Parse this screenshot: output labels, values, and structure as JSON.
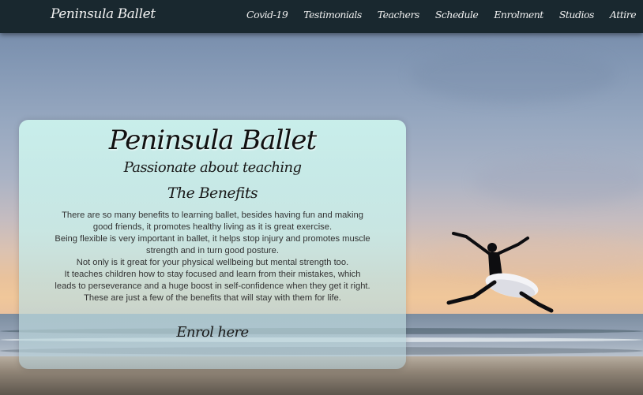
{
  "nav": {
    "brand": "Peninsula Ballet",
    "links": [
      "Covid-19",
      "Testimonials",
      "Teachers",
      "Schedule",
      "Enrolment",
      "Studios",
      "Attire"
    ]
  },
  "hero": {
    "title": "Peninsula Ballet",
    "tagline": "Passionate about teaching",
    "subheading": "The Benefits",
    "paragraphs": [
      "There are so many benefits to learning ballet, besides having fun and making good friends, it promotes healthy living as it is great exercise.",
      "Being flexible is very important in ballet, it helps stop injury and promotes muscle strength and in turn good posture.",
      "Not only is it great for your physical wellbeing but mental strength too.",
      "It teaches children how to stay focused and learn from their mistakes, which leads to perseverance and a huge boost in self-confidence when they get it right. These are just a few of the benefits that will stay with them for life."
    ],
    "cta": "Enrol here"
  },
  "colors": {
    "navbar": "#19282f",
    "card": "#cdf4ee",
    "text": "#333333"
  }
}
